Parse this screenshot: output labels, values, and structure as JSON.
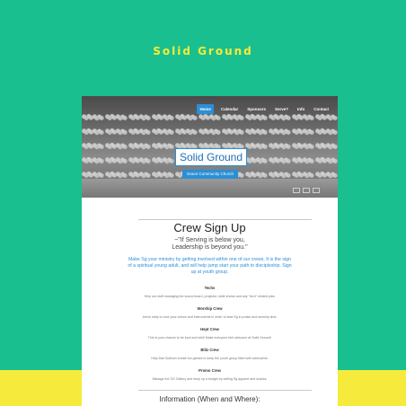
{
  "brand": {
    "title": "Solid Ground"
  },
  "nav": {
    "items": [
      {
        "label": "Home",
        "active": true
      },
      {
        "label": "Calendar",
        "active": false
      },
      {
        "label": "Sponsors",
        "active": false
      },
      {
        "label": "Serve?",
        "active": false
      },
      {
        "label": "Info",
        "active": false
      },
      {
        "label": "Contact",
        "active": false
      }
    ]
  },
  "hero": {
    "logo_text": "Solid Ground",
    "church_tag": "Grace Community Church"
  },
  "page": {
    "title": "Crew Sign Up",
    "quote_line1": "~\"If Serving is below you,",
    "quote_line2": "Leadership is beyond you.\"",
    "intro": "Make Sg your ministry by getting involved within one of our crews. It is the sign of a spiritual young adult, and will help jump start your path to discipleship. Sign up at youth group."
  },
  "crews": [
    {
      "name": "Techs",
      "desc": "Help our stuff managing the sound board, projector, slide shows and any \"tech\" related jobs."
    },
    {
      "name": "Worship Crew",
      "desc": "Arrive early to tune your voices and instruments in order to lead Sg in praise and worship time."
    },
    {
      "name": "Hept Crew",
      "desc": "This is your chance to be loud and wild! Make everyone feel welcome at Solid Ground!"
    },
    {
      "name": "Blitz Crew",
      "desc": "Help Dan Bothum create fun games to keep the youth group filled with adrenaline."
    },
    {
      "name": "Promo Crew",
      "desc": "Manage the SG Gallery and keep up a budget by selling Sg apparel and snacks."
    }
  ],
  "info": {
    "title": "Information (When and Where):"
  },
  "colors": {
    "background": "#1abf8f",
    "accent_yellow": "#f6eb3c",
    "accent_blue": "#2b8fd6"
  }
}
